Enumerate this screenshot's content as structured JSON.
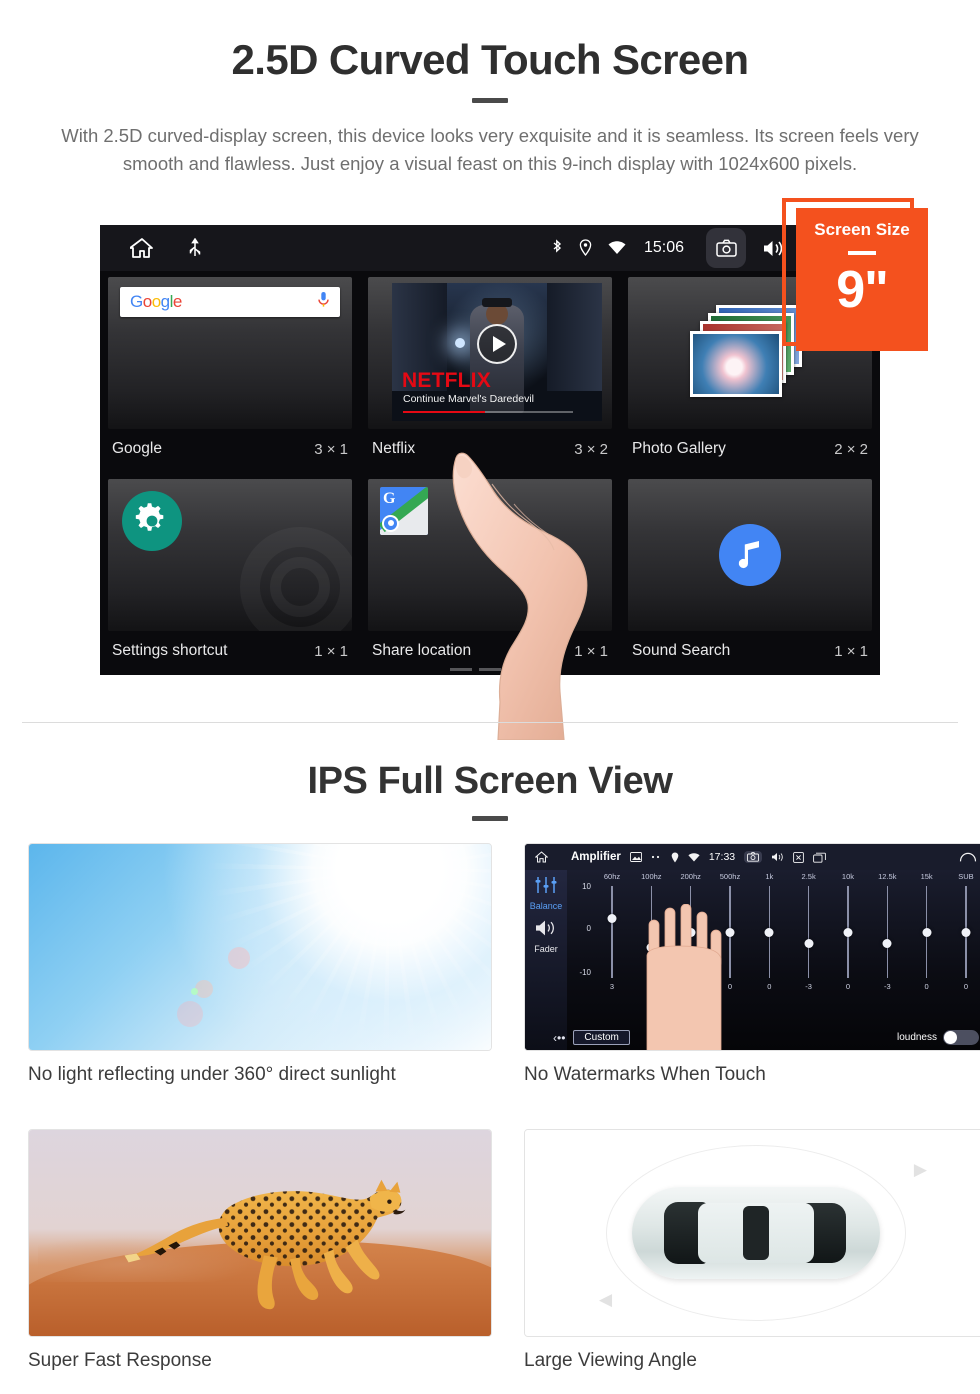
{
  "section1": {
    "title": "2.5D Curved Touch Screen",
    "description": "With 2.5D curved-display screen, this device looks very exquisite and it is seamless. Its screen feels very smooth and flawless. Just enjoy a visual feast on this 9-inch display with 1024x600 pixels."
  },
  "badge": {
    "label": "Screen Size",
    "value": "9\"",
    "color": "#f4511e"
  },
  "device": {
    "statusbar": {
      "home_icon": "home-icon",
      "usb_icon": "usb-icon",
      "bluetooth_icon": "bluetooth-icon",
      "location_icon": "location-pin-icon",
      "wifi_icon": "wifi-icon",
      "time": "15:06",
      "camera_icon": "camera-icon",
      "volume_icon": "volume-icon",
      "close_icon": "close-box-icon",
      "recents_icon": "recent-apps-icon"
    },
    "widgets": [
      {
        "name": "Google",
        "size": "3 × 1",
        "icon": "google-search-widget",
        "logo": "Google"
      },
      {
        "name": "Netflix",
        "size": "3 × 2",
        "icon": "netflix-widget",
        "brand": "NETFLIX",
        "subtitle": "Continue Marvel's Daredevil"
      },
      {
        "name": "Photo Gallery",
        "size": "2 × 2",
        "icon": "photo-gallery-widget"
      },
      {
        "name": "Settings shortcut",
        "size": "1 × 1",
        "icon": "settings-gear-icon"
      },
      {
        "name": "Share location",
        "size": "1 × 1",
        "icon": "google-maps-icon"
      },
      {
        "name": "Sound Search",
        "size": "1 × 1",
        "icon": "music-note-icon"
      }
    ],
    "page_dots": 3,
    "active_dot": 3
  },
  "section2": {
    "title": "IPS Full Screen View",
    "cards": [
      {
        "caption": "No light reflecting under 360° direct sunlight",
        "media": "sunlight-photo"
      },
      {
        "caption": "No Watermarks When Touch",
        "media": "amplifier-screenshot"
      },
      {
        "caption": "Super Fast Response",
        "media": "cheetah-photo"
      },
      {
        "caption": "Large Viewing Angle",
        "media": "car-top-view"
      }
    ]
  },
  "amplifier": {
    "title": "Amplifier",
    "time": "17:33",
    "sidebar": {
      "balance": "Balance",
      "fader": "Fader"
    },
    "bands": [
      "60hz",
      "100hz",
      "200hz",
      "500hz",
      "1k",
      "2.5k",
      "10k",
      "12.5k",
      "15k",
      "SUB"
    ],
    "values": [
      "3",
      "-4",
      "0",
      "0",
      "0",
      "-3",
      "0",
      "-3",
      "0",
      "0"
    ],
    "scale": {
      "top": "10",
      "mid": "0",
      "bottom": "-10"
    },
    "preset": "Custom",
    "loudness_label": "loudness",
    "loudness_on": false
  }
}
